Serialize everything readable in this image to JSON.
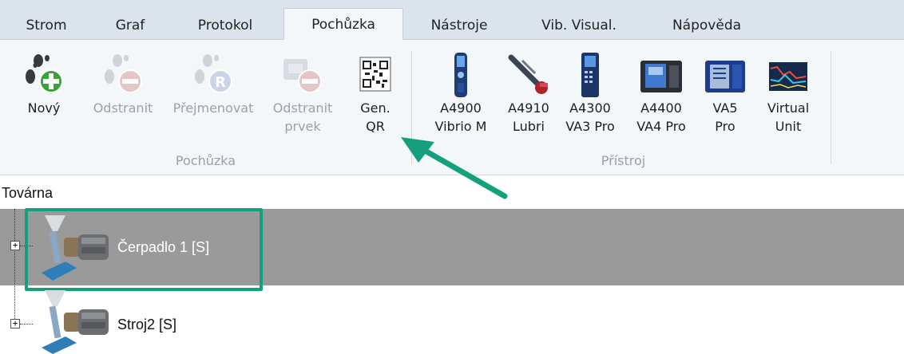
{
  "tabs": [
    {
      "label": "Strom"
    },
    {
      "label": "Graf"
    },
    {
      "label": "Protokol"
    },
    {
      "label": "Pochůzka"
    },
    {
      "label": "Nástroje"
    },
    {
      "label": "Vib. Visual."
    },
    {
      "label": "Nápověda"
    }
  ],
  "active_tab": "Pochůzka",
  "ribbon": {
    "route_group": {
      "label": "Pochůzka",
      "buttons": [
        {
          "line1": "Nový",
          "line2": "",
          "icon": "footprint-add-icon",
          "enabled": true
        },
        {
          "line1": "Odstranit",
          "line2": "",
          "icon": "footprint-remove-icon",
          "enabled": false
        },
        {
          "line1": "Přejmenovat",
          "line2": "",
          "icon": "footprint-rename-icon",
          "enabled": false
        },
        {
          "line1": "Odstranit",
          "line2": "prvek",
          "icon": "remove-item-icon",
          "enabled": false
        },
        {
          "line1": "Gen.",
          "line2": "QR",
          "icon": "qr-code-icon",
          "enabled": true
        }
      ]
    },
    "device_group": {
      "label": "Přístroj",
      "buttons": [
        {
          "line1": "A4900",
          "line2": "Vibrio M",
          "icon": "vibrio-m-device-icon"
        },
        {
          "line1": "A4910",
          "line2": "Lubri",
          "icon": "lubri-device-icon"
        },
        {
          "line1": "A4300",
          "line2": "VA3 Pro",
          "icon": "va3-pro-device-icon"
        },
        {
          "line1": "A4400",
          "line2": "VA4 Pro",
          "icon": "va4-pro-device-icon"
        },
        {
          "line1": "VA5",
          "line2": "Pro",
          "icon": "va5-pro-device-icon"
        },
        {
          "line1": "Virtual",
          "line2": "Unit",
          "icon": "virtual-unit-icon"
        }
      ]
    }
  },
  "tree": {
    "root": "Továrna",
    "nodes": [
      {
        "label": "Čerpadlo 1 [S]",
        "icon": "pump-machine-icon",
        "selected": true,
        "expander": "+"
      },
      {
        "label": "Stroj2 [S]",
        "icon": "pump-machine-icon",
        "selected": false,
        "expander": "+"
      }
    ]
  },
  "colors": {
    "highlight": "#14a07c",
    "selected_row": "#9a9a9a",
    "ribbon_bg": "#f4f7fa",
    "tabbar_bg": "#dbe3ec"
  }
}
